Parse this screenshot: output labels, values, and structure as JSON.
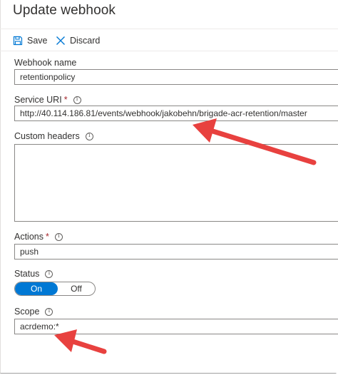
{
  "page": {
    "title": "Update webhook"
  },
  "toolbar": {
    "save_label": "Save",
    "discard_label": "Discard"
  },
  "form": {
    "webhook_name": {
      "label": "Webhook name",
      "value": "retentionpolicy"
    },
    "service_uri": {
      "label": "Service URI",
      "required": "*",
      "value": "http://40.114.186.81/events/webhook/jakobehn/brigade-acr-retention/master"
    },
    "custom_headers": {
      "label": "Custom headers",
      "value": ""
    },
    "actions": {
      "label": "Actions",
      "required": "*",
      "value": "push"
    },
    "status": {
      "label": "Status",
      "on_label": "On",
      "off_label": "Off",
      "selected": "On"
    },
    "scope": {
      "label": "Scope",
      "value": "acrdemo:*"
    }
  },
  "colors": {
    "accent": "#0078d4",
    "arrow": "#e8413f",
    "required": "#a4262c"
  },
  "icons": {
    "save": "save-icon",
    "discard": "close-icon",
    "info": "info-icon"
  }
}
